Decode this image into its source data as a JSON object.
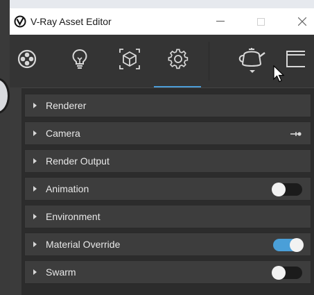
{
  "window": {
    "title": "V-Ray Asset Editor",
    "minimize_icon": "minimize-icon",
    "maximize_icon": "maximize-icon",
    "close_icon": "close-icon"
  },
  "toolbar": {
    "tools": [
      {
        "name": "materials",
        "icon": "material-sphere-icon",
        "active": false
      },
      {
        "name": "lights",
        "icon": "light-bulb-icon",
        "active": false
      },
      {
        "name": "geometry",
        "icon": "geometry-cube-icon",
        "active": false
      },
      {
        "name": "settings",
        "icon": "gear-icon",
        "active": true
      },
      {
        "name": "render",
        "icon": "teapot-render-icon",
        "active": false
      },
      {
        "name": "frame-buffer",
        "icon": "frame-buffer-icon",
        "active": false
      }
    ]
  },
  "settings": {
    "rows": [
      {
        "label": "Renderer",
        "control": "none"
      },
      {
        "label": "Camera",
        "control": "camera-icon"
      },
      {
        "label": "Render Output",
        "control": "none"
      },
      {
        "label": "Animation",
        "control": "toggle",
        "enabled": false
      },
      {
        "label": "Environment",
        "control": "none"
      },
      {
        "label": "Material Override",
        "control": "toggle",
        "enabled": true
      },
      {
        "label": "Swarm",
        "control": "toggle",
        "enabled": false
      }
    ]
  },
  "colors": {
    "accent": "#4a9fd8",
    "panel_bg": "#2c2c2c",
    "row_bg": "#3d3d3d",
    "toolbar_bg": "#343434",
    "titlebar_bg": "#ffffff"
  }
}
